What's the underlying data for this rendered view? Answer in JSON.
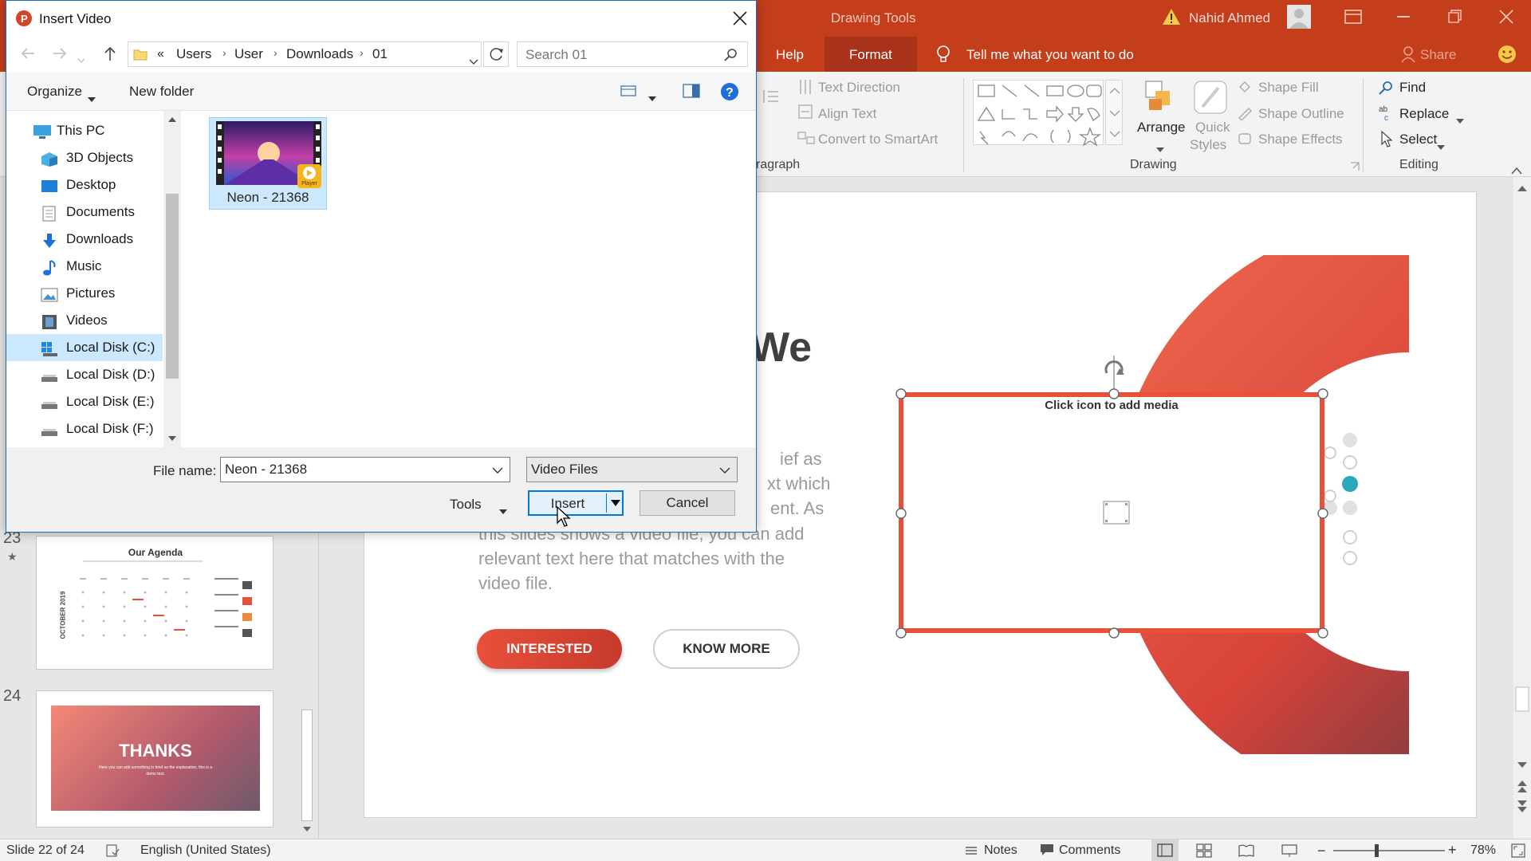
{
  "ppt": {
    "context_tab": "Drawing Tools",
    "user_name": "Nahid Ahmed",
    "tabs": [
      "Help",
      "Format"
    ],
    "tell_me": "Tell me what you want to do",
    "share": "Share",
    "ribbon": {
      "text_direction": "Text Direction",
      "align_text": "Align Text",
      "convert_smartart": "Convert to SmartArt",
      "paragraph_group": "ragraph",
      "arrange": "Arrange",
      "quick_styles_1": "Quick",
      "quick_styles_2": "Styles",
      "shape_fill": "Shape Fill",
      "shape_outline": "Shape Outline",
      "shape_effects": "Shape Effects",
      "drawing_group": "Drawing",
      "find": "Find",
      "replace": "Replace",
      "select": "Select",
      "editing_group": "Editing"
    },
    "slide": {
      "heading_partial": "We",
      "body_lines": [
        "ief as",
        "xt which",
        "ent. As",
        "this slides shows a video file, you can add",
        "relevant text here that matches with the",
        "video file."
      ],
      "button_interested": "INTERESTED",
      "button_know_more": "KNOW MORE",
      "placeholder_label": "Click icon to add media"
    },
    "thumbnails": [
      {
        "number": "23",
        "title": "Our Agenda",
        "side_text": "OCTOBER 2019"
      },
      {
        "number": "24",
        "title": "THANKS",
        "subtitle": "Here you can add something in brief as the explanation, this is a demo text."
      }
    ],
    "status": {
      "slide_info": "Slide 22 of 24",
      "language": "English (United States)",
      "notes": "Notes",
      "comments": "Comments",
      "zoom": "78%"
    }
  },
  "dialog": {
    "title": "Insert Video",
    "breadcrumb": [
      "«",
      "Users",
      "User",
      "Downloads",
      "01"
    ],
    "search_placeholder": "Search 01",
    "organize": "Organize",
    "new_folder": "New folder",
    "nav_items": [
      "This PC",
      "3D Objects",
      "Desktop",
      "Documents",
      "Downloads",
      "Music",
      "Pictures",
      "Videos",
      "Local Disk (C:)",
      "Local Disk (D:)",
      "Local Disk (E:)",
      "Local Disk (F:)"
    ],
    "selected_nav": "Local Disk (C:)",
    "file": {
      "name": "Neon - 21368",
      "badge": "Player"
    },
    "file_name_label": "File name:",
    "file_name_value": "Neon - 21368",
    "file_type": "Video Files",
    "tools": "Tools",
    "insert": "Insert",
    "cancel": "Cancel"
  },
  "colors": {
    "accent": "#c43e1c",
    "dialog_border": "#1c6fb8",
    "selection": "#cce8ff",
    "slide_red": "#e8503a"
  }
}
